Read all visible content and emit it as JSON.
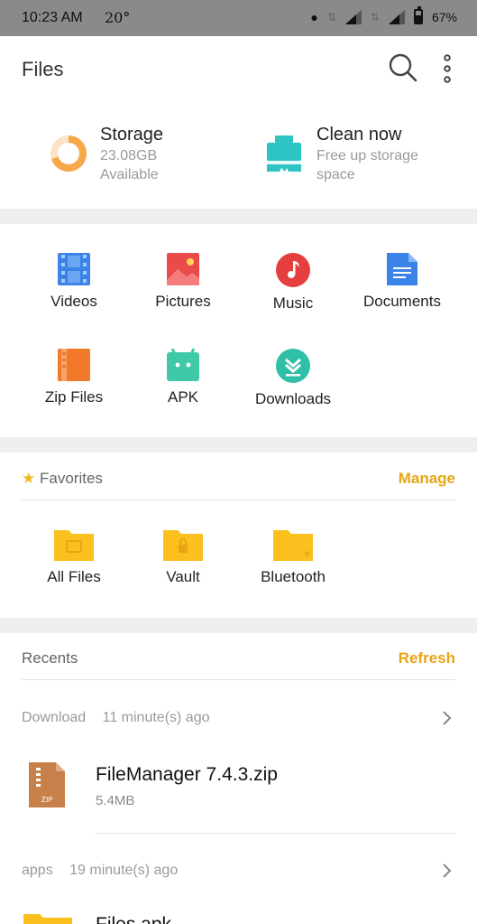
{
  "status_bar": {
    "time": "10:23 AM",
    "temperature": "20°",
    "battery": "67%"
  },
  "app_bar": {
    "title": "Files"
  },
  "storage": {
    "title": "Storage",
    "amount": "23.08GB",
    "available": "Available",
    "used_fraction": 0.3
  },
  "clean": {
    "title": "Clean now",
    "line1": "Free up storage",
    "line2": "space"
  },
  "categories": [
    {
      "label": "Videos"
    },
    {
      "label": "Pictures"
    },
    {
      "label": "Music"
    },
    {
      "label": "Documents"
    },
    {
      "label": "Zip Files"
    },
    {
      "label": "APK"
    },
    {
      "label": "Downloads"
    }
  ],
  "favorites": {
    "heading": "Favorites",
    "action": "Manage",
    "items": [
      {
        "label": "All Files"
      },
      {
        "label": "Vault"
      },
      {
        "label": "Bluetooth"
      }
    ]
  },
  "recents": {
    "heading": "Recents",
    "action": "Refresh",
    "groups": [
      {
        "source": "Download",
        "time": "11 minute(s) ago",
        "file": {
          "name": "FileManager 7.4.3.zip",
          "size": "5.4MB",
          "badge": "ZIP"
        }
      },
      {
        "source": "apps",
        "time": "19 minute(s) ago",
        "file": {
          "name": "Files.apk"
        }
      }
    ]
  },
  "colors": {
    "accent": "#e8a414",
    "folder": "#fbbf1e"
  }
}
